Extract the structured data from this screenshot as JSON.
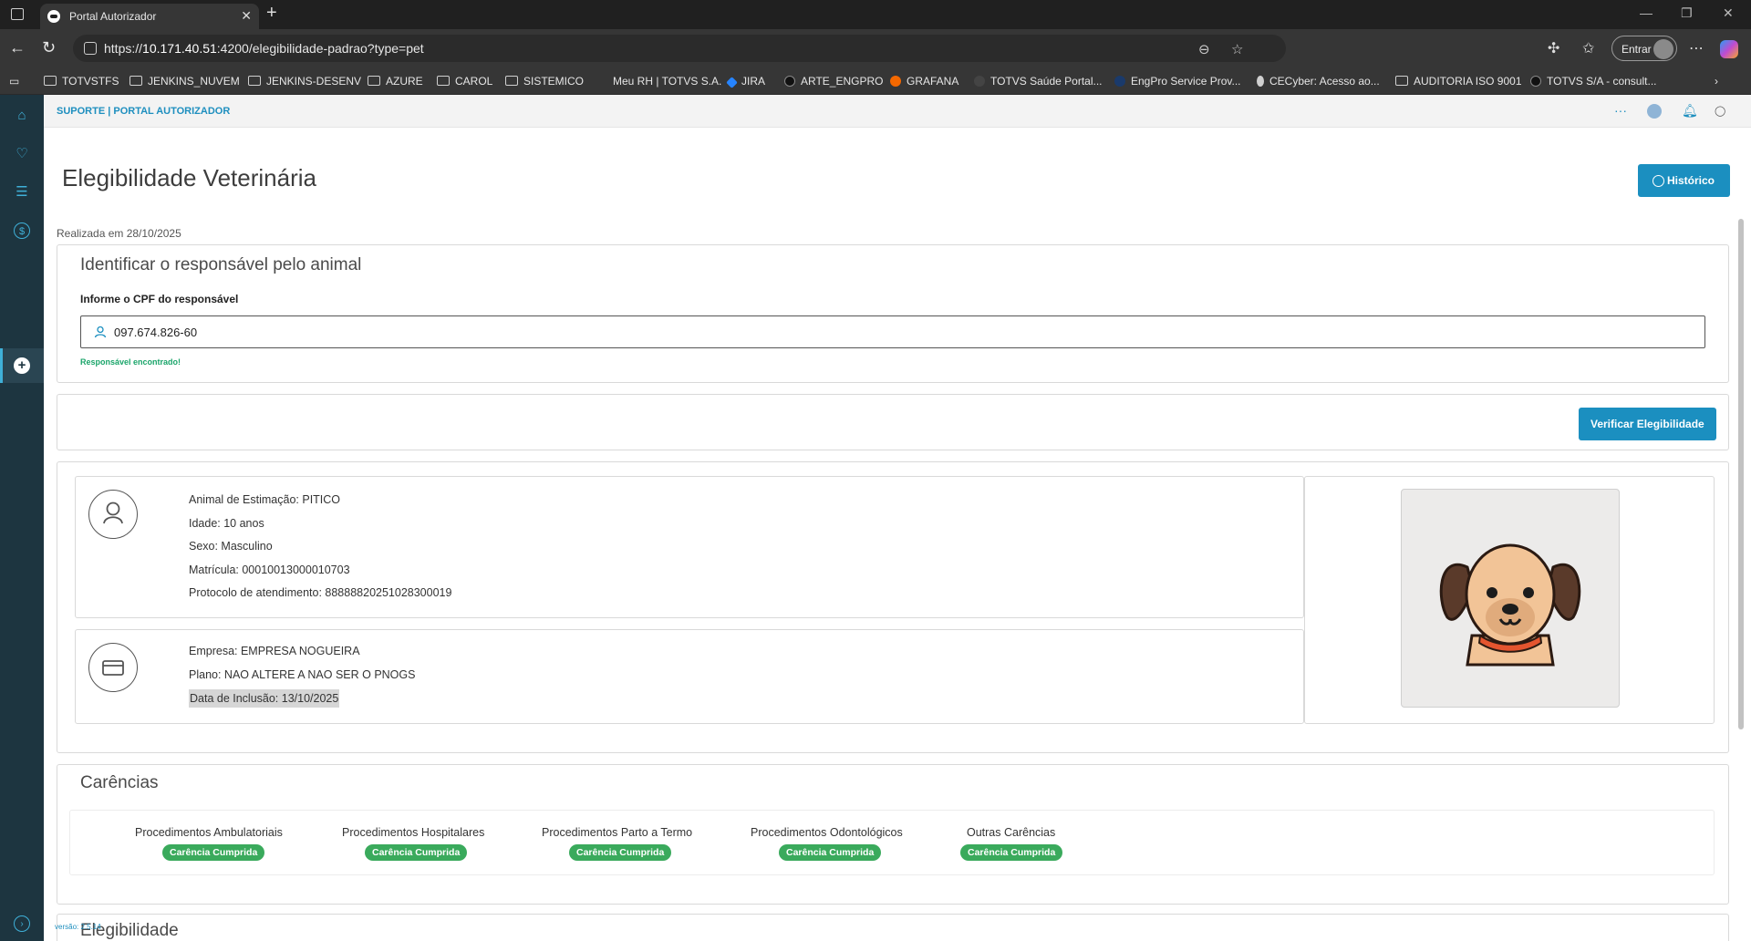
{
  "browser": {
    "tab_title": "Portal Autorizador",
    "tab_close": "✕",
    "new_tab": "+",
    "url_prefix": "https://",
    "url_host": "10.171.40.51",
    "url_rest": ":4200/elegibilidade-padrao?type=pet",
    "signin_label": "Entrar",
    "more_label": "⋯"
  },
  "bookmarks": [
    {
      "label": "TOTVSTFS",
      "icon": "folder-icon"
    },
    {
      "label": "JENKINS_NUVEM",
      "icon": "folder-icon"
    },
    {
      "label": "JENKINS-DESENV",
      "icon": "folder-icon"
    },
    {
      "label": "AZURE",
      "icon": "folder-icon"
    },
    {
      "label": "CAROL",
      "icon": "folder-icon"
    },
    {
      "label": "SISTEMICO",
      "icon": "folder-icon"
    },
    {
      "label": "Meu RH | TOTVS S.A.",
      "icon": "none"
    },
    {
      "label": "JIRA",
      "icon": "jira-icon"
    },
    {
      "label": "ARTE_ENGPRO",
      "icon": "site-icon"
    },
    {
      "label": "GRAFANA",
      "icon": "grafana-icon"
    },
    {
      "label": "TOTVS Saúde Portal...",
      "icon": "site-icon"
    },
    {
      "label": "EngPro Service Prov...",
      "icon": "site-icon"
    },
    {
      "label": "CECyber: Acesso ao...",
      "icon": "site-icon"
    },
    {
      "label": "AUDITORIA ISO 9001",
      "icon": "folder-icon"
    },
    {
      "label": "TOTVS S/A - consult...",
      "icon": "site-icon"
    }
  ],
  "app": {
    "breadcrumb": "SUPORTE | PORTAL AUTORIZADOR",
    "title": "Elegibilidade Veterinária",
    "history_label": "Histórico",
    "realizada": "Realizada em 28/10/2025",
    "version": "versão: 2.5.14"
  },
  "identify": {
    "title": "Identificar o responsável pelo animal",
    "cpf_label": "Informe o CPF do responsável",
    "cpf_value": "097.674.826-60",
    "found_msg": "Responsável encontrado!"
  },
  "verify": {
    "button_label": "Verificar Elegibilidade"
  },
  "pet": {
    "nome": "Animal de Estimação: PITICO",
    "idade": "Idade: 10 anos",
    "sexo": "Sexo: Masculino",
    "matricula": "Matrícula: 00010013000010703",
    "protocolo": "Protocolo de atendimento: 88888820251028300019"
  },
  "plan": {
    "empresa": "Empresa: EMPRESA NOGUEIRA",
    "plano": "Plano: NAO ALTERE A NAO SER O PNOGS",
    "inclusao": "Data de Inclusão: 13/10/2025"
  },
  "carencias": {
    "title": "Carências",
    "items": [
      {
        "label": "Procedimentos Ambulatoriais",
        "status": "Carência Cumprida"
      },
      {
        "label": "Procedimentos Hospitalares",
        "status": "Carência Cumprida"
      },
      {
        "label": "Procedimentos Parto a Termo",
        "status": "Carência Cumprida"
      },
      {
        "label": "Procedimentos Odontológicos",
        "status": "Carência Cumprida"
      },
      {
        "label": "Outras Carências",
        "status": "Carência Cumprida"
      }
    ]
  },
  "elegibilidade": {
    "title": "Elegibilidade"
  },
  "colors": {
    "accent": "#1b8fc0",
    "success": "#3aaa5c",
    "sidebar": "#1d3540"
  }
}
